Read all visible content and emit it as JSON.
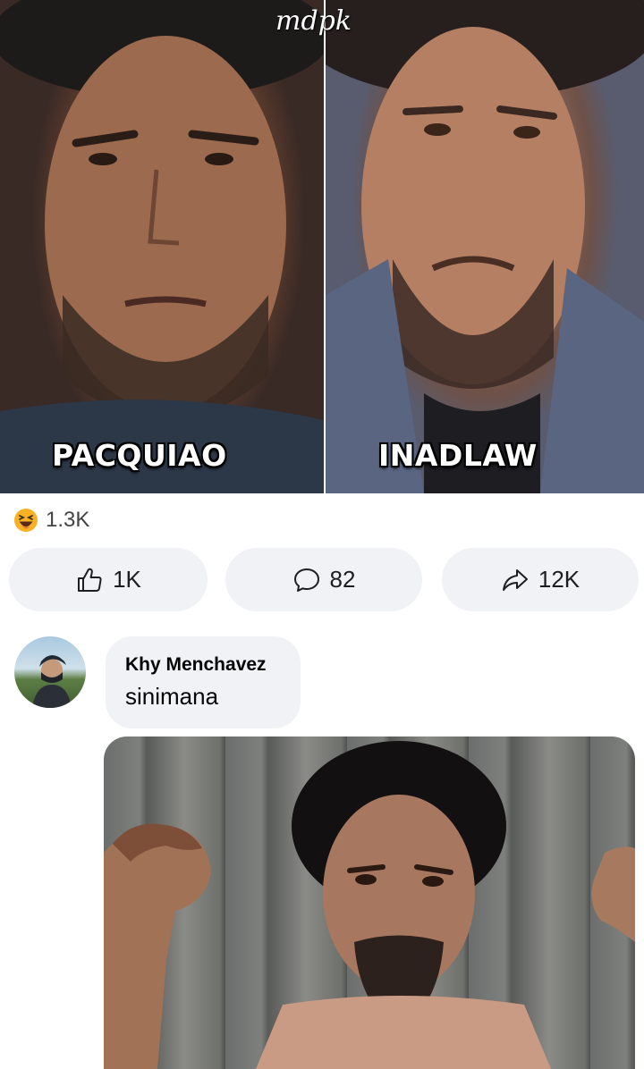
{
  "meme": {
    "watermark": "mdpk",
    "left_caption": "PACQUIAO",
    "right_caption": "INADLAW"
  },
  "reactions": {
    "icon": "haha-emoji-icon",
    "count": "1.3K"
  },
  "actions": {
    "like": {
      "icon": "thumbs-up-icon",
      "count": "1K"
    },
    "comment": {
      "icon": "comment-bubble-icon",
      "count": "82"
    },
    "share": {
      "icon": "share-arrow-icon",
      "count": "12K"
    }
  },
  "comment": {
    "author": "Khy Menchavez",
    "text": "sinimana"
  },
  "colors": {
    "button_bg": "#f0f2f5",
    "text": "#050505",
    "haha_yellow": "#f7b125"
  }
}
